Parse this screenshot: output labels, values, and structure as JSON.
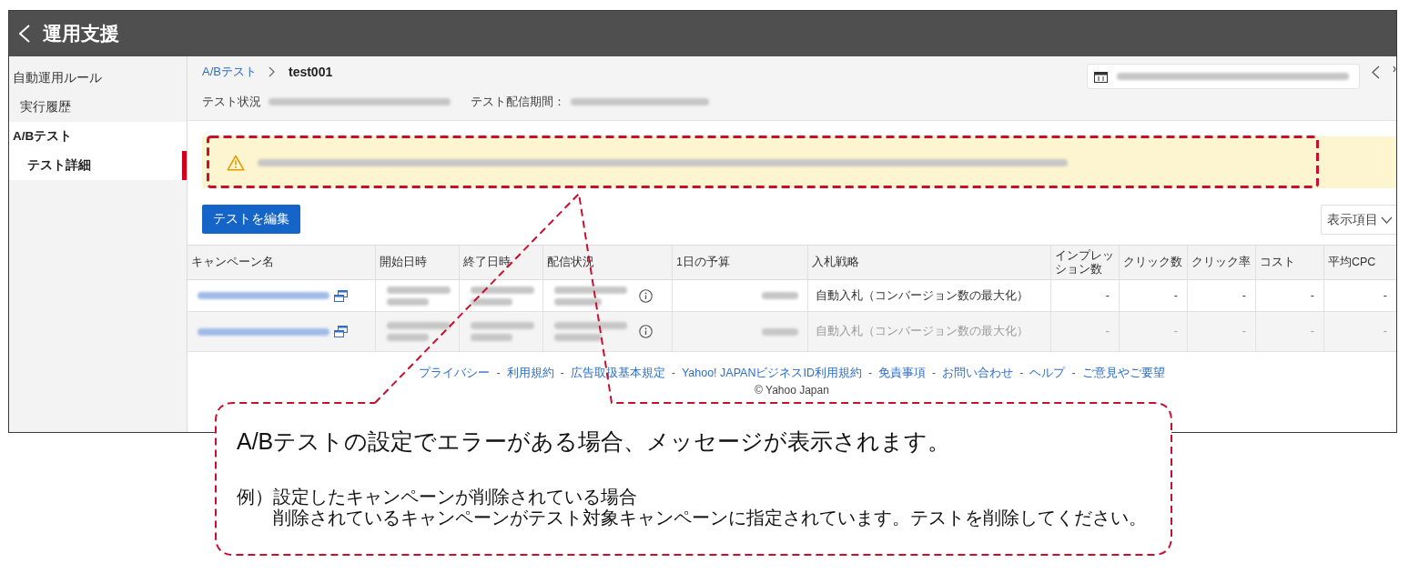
{
  "header": {
    "title": "運用支援"
  },
  "sidebar": {
    "items": [
      {
        "label": "自動運用ルール",
        "selected": false,
        "children": [
          {
            "label": "実行履歴",
            "selected": false
          }
        ]
      },
      {
        "label": "A/Bテスト",
        "selected": true,
        "children": [
          {
            "label": "テスト詳細",
            "selected": true
          }
        ]
      }
    ]
  },
  "breadcrumb": {
    "items": [
      {
        "label": "A/Bテスト",
        "kind": "link"
      },
      {
        "label": "test001",
        "kind": "current"
      }
    ]
  },
  "test_info": {
    "status_label": "テスト状況",
    "period_label": "テスト配信期間："
  },
  "toolbar": {
    "edit_button": "テストを編集",
    "columns_dropdown": "表示項目"
  },
  "table": {
    "columns": [
      "キャンペーン名",
      "開始日時",
      "終了日時",
      "配信状況",
      "1日の予算",
      "入札戦略",
      "インプレッション数",
      "クリック数",
      "クリック率",
      "コスト",
      "平均CPC"
    ],
    "rows": [
      {
        "disabled": false,
        "bid_strategy": "自動入札（コンバージョン数の最大化）",
        "metrics": [
          "-",
          "-",
          "-",
          "-",
          "-"
        ]
      },
      {
        "disabled": true,
        "bid_strategy": "自動入札（コンバージョン数の最大化）",
        "metrics": [
          "-",
          "-",
          "-",
          "-",
          "-"
        ]
      }
    ]
  },
  "footer": {
    "items": [
      {
        "kind": "link",
        "text": "プライバシー"
      },
      {
        "kind": "separator",
        "text": "-"
      },
      {
        "kind": "link",
        "text": "利用規約"
      },
      {
        "kind": "separator",
        "text": "-"
      },
      {
        "kind": "link",
        "text": "広告取扱基本規定"
      },
      {
        "kind": "separator",
        "text": "-"
      },
      {
        "kind": "link",
        "text": "Yahoo! JAPANビジネスID利用規約"
      },
      {
        "kind": "separator",
        "text": "-"
      },
      {
        "kind": "link",
        "text": "免責事項"
      },
      {
        "kind": "separator",
        "text": "-"
      },
      {
        "kind": "link",
        "text": "お問い合わせ"
      },
      {
        "kind": "separator",
        "text": "-"
      },
      {
        "kind": "link",
        "text": "ヘルプ"
      },
      {
        "kind": "separator",
        "text": "-"
      },
      {
        "kind": "link",
        "text": "ご意見やご要望"
      }
    ],
    "copyright": "© Yahoo Japan"
  },
  "annotation": {
    "heading": "A/Bテストの設定でエラーがある場合、メッセージが表示されます。",
    "example_label": "例）",
    "example_lines": [
      "設定したキャンペーンが削除されている場合",
      "削除されているキャンペーンがテスト対象キャンペーンに指定されています。テストを削除してください。"
    ]
  }
}
